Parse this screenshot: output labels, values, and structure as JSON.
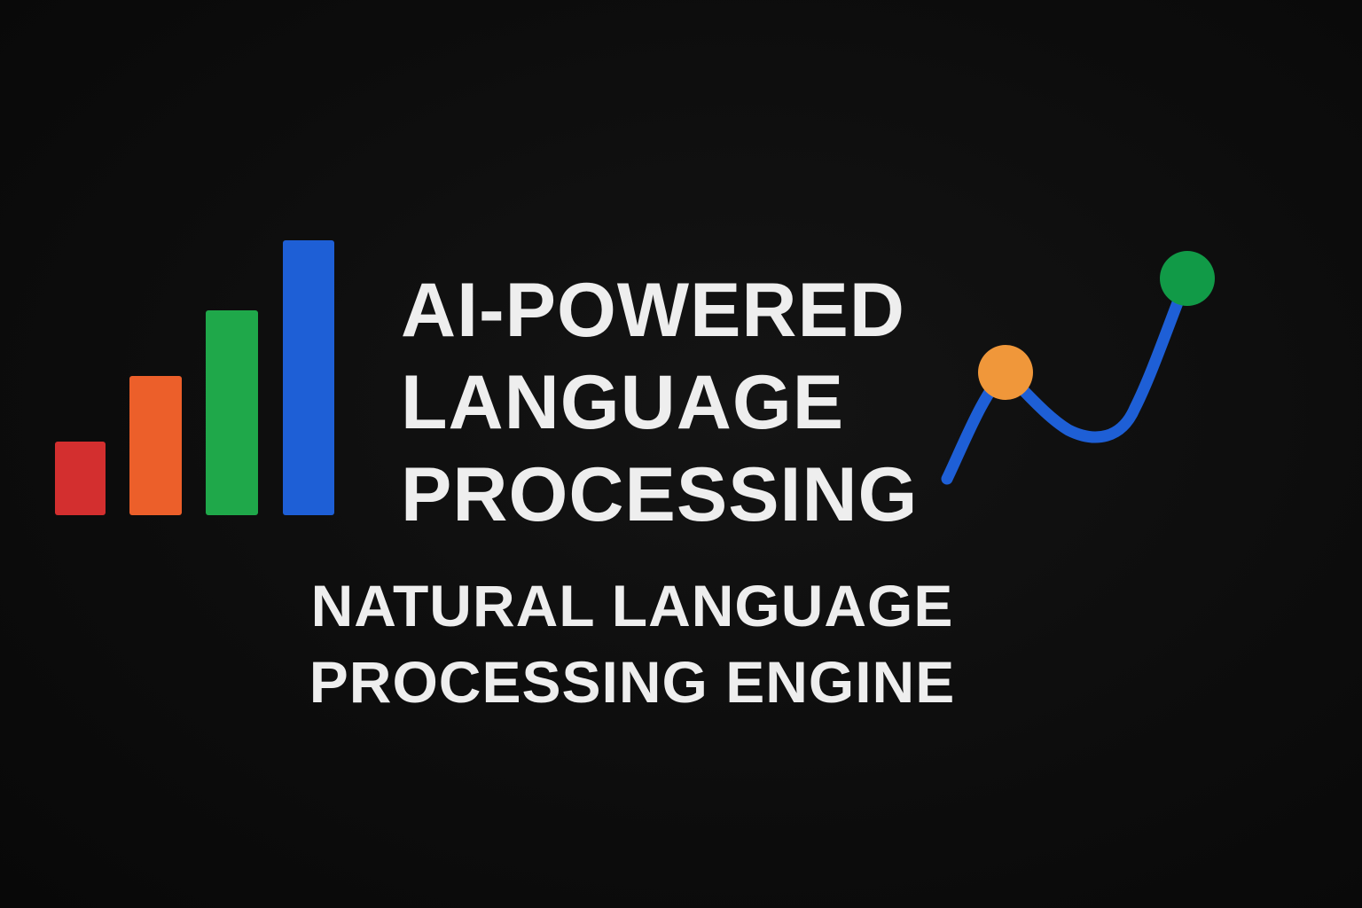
{
  "logo": {
    "icon": "bar-chart-icon",
    "bar_colors": [
      "#d32f2f",
      "#ec5f2a",
      "#1fa84a",
      "#1e5fd6"
    ],
    "relative_heights": [
      0.27,
      0.51,
      0.75,
      1.0
    ]
  },
  "headline": {
    "lines": [
      "AI-POWERED",
      "LANGUAGE",
      "PROCESSING"
    ]
  },
  "subheadline": {
    "lines": [
      "NATURAL LANGUAGE",
      "PROCESSING ENGINE"
    ]
  },
  "trend_icon": {
    "icon": "trend-line-icon",
    "line_color": "#1e5fd6",
    "marker_colors": [
      "#f0973a",
      "#119a47"
    ]
  },
  "colors": {
    "background": "#0b0b0b",
    "text": "#eeeeee"
  }
}
